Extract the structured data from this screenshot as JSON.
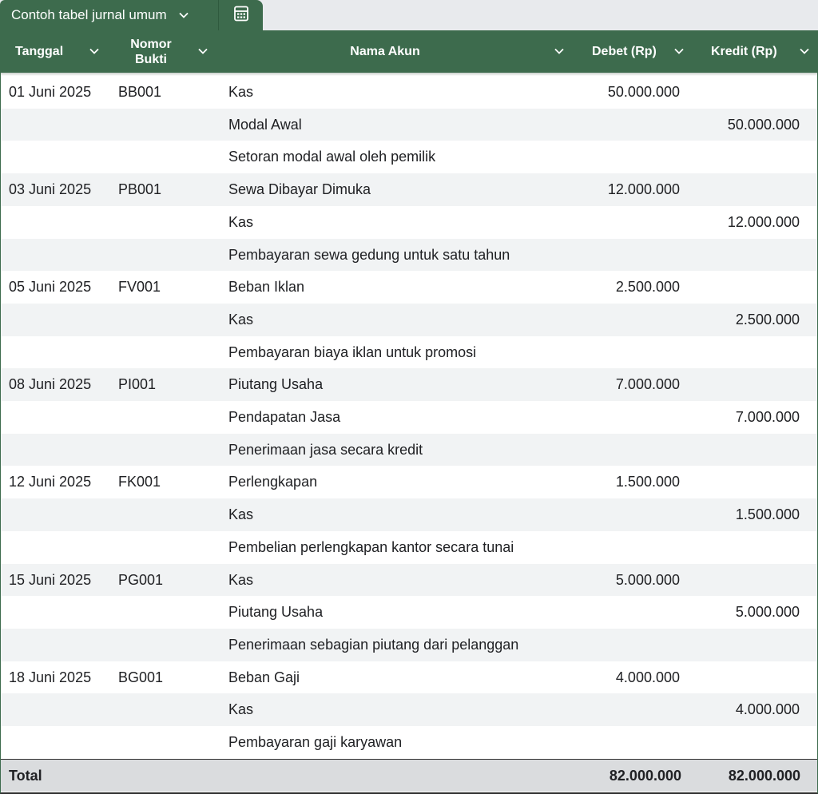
{
  "sheet_tab": {
    "label": "Contoh tabel jurnal umum"
  },
  "columns": {
    "date": "Tanggal",
    "ref": "Nomor Bukti",
    "account": "Nama Akun",
    "debit": "Debet (Rp)",
    "credit": "Kredit (Rp)"
  },
  "rows": [
    {
      "date": "01 Juni 2025",
      "ref": "BB001",
      "account": "Kas",
      "debit": "50.000.000",
      "credit": ""
    },
    {
      "date": "",
      "ref": "",
      "account": "Modal Awal",
      "debit": "",
      "credit": "50.000.000"
    },
    {
      "date": "",
      "ref": "",
      "account": "Setoran modal awal oleh pemilik",
      "debit": "",
      "credit": ""
    },
    {
      "date": "03 Juni 2025",
      "ref": "PB001",
      "account": "Sewa Dibayar Dimuka",
      "debit": "12.000.000",
      "credit": ""
    },
    {
      "date": "",
      "ref": "",
      "account": "Kas",
      "debit": "",
      "credit": "12.000.000"
    },
    {
      "date": "",
      "ref": "",
      "account": "Pembayaran sewa gedung untuk satu tahun",
      "debit": "",
      "credit": ""
    },
    {
      "date": "05 Juni 2025",
      "ref": "FV001",
      "account": "Beban Iklan",
      "debit": "2.500.000",
      "credit": ""
    },
    {
      "date": "",
      "ref": "",
      "account": "Kas",
      "debit": "",
      "credit": "2.500.000"
    },
    {
      "date": "",
      "ref": "",
      "account": "Pembayaran biaya iklan untuk promosi",
      "debit": "",
      "credit": ""
    },
    {
      "date": "08 Juni 2025",
      "ref": "PI001",
      "account": "Piutang Usaha",
      "debit": "7.000.000",
      "credit": ""
    },
    {
      "date": "",
      "ref": "",
      "account": "Pendapatan Jasa",
      "debit": "",
      "credit": "7.000.000"
    },
    {
      "date": "",
      "ref": "",
      "account": "Penerimaan jasa secara kredit",
      "debit": "",
      "credit": ""
    },
    {
      "date": "12 Juni 2025",
      "ref": "FK001",
      "account": "Perlengkapan",
      "debit": "1.500.000",
      "credit": ""
    },
    {
      "date": "",
      "ref": "",
      "account": "Kas",
      "debit": "",
      "credit": "1.500.000"
    },
    {
      "date": "",
      "ref": "",
      "account": "Pembelian perlengkapan kantor secara tunai",
      "debit": "",
      "credit": ""
    },
    {
      "date": "15 Juni 2025",
      "ref": "PG001",
      "account": "Kas",
      "debit": "5.000.000",
      "credit": ""
    },
    {
      "date": "",
      "ref": "",
      "account": "Piutang Usaha",
      "debit": "",
      "credit": "5.000.000"
    },
    {
      "date": "",
      "ref": "",
      "account": "Penerimaan sebagian piutang dari pelanggan",
      "debit": "",
      "credit": ""
    },
    {
      "date": "18 Juni 2025",
      "ref": "BG001",
      "account": "Beban Gaji",
      "debit": "4.000.000",
      "credit": ""
    },
    {
      "date": "",
      "ref": "",
      "account": "Kas",
      "debit": "",
      "credit": "4.000.000"
    },
    {
      "date": "",
      "ref": "",
      "account": "Pembayaran gaji karyawan",
      "debit": "",
      "credit": ""
    }
  ],
  "total": {
    "label": "Total",
    "debit": "82.000.000",
    "credit": "82.000.000"
  },
  "colors": {
    "header_green": "#3d6b4d",
    "alt_row": "#f1f3f4",
    "total_bg": "#dadcde"
  }
}
